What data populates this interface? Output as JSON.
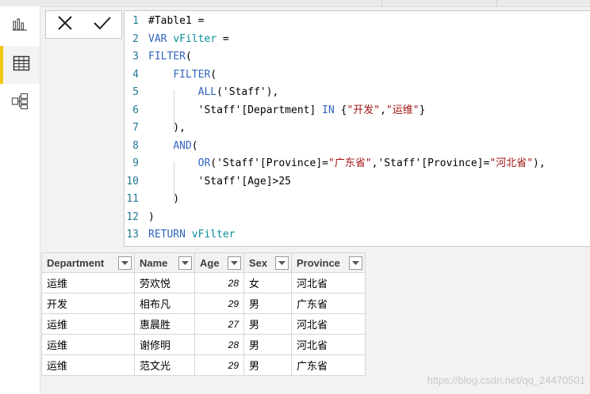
{
  "nav": {
    "items": [
      {
        "name": "report-view",
        "icon": "bar-chart-icon",
        "active": false
      },
      {
        "name": "data-view",
        "icon": "table-grid-icon",
        "active": true
      },
      {
        "name": "model-view",
        "icon": "model-diagram-icon",
        "active": false
      }
    ]
  },
  "formula_bar": {
    "cancel_icon": "close-x-icon",
    "commit_icon": "checkmark-icon",
    "lines": [
      {
        "n": "1",
        "text": "#Table1 ="
      },
      {
        "n": "2",
        "text": "VAR vFilter ="
      },
      {
        "n": "3",
        "text": "FILTER("
      },
      {
        "n": "4",
        "text": "    FILTER("
      },
      {
        "n": "5",
        "text": "        ALL('Staff'),"
      },
      {
        "n": "6",
        "text": "        'Staff'[Department] IN {\"开发\",\"运维\"}"
      },
      {
        "n": "7",
        "text": "    ),"
      },
      {
        "n": "8",
        "text": "    AND("
      },
      {
        "n": "9",
        "text": "        OR('Staff'[Province]=\"广东省\",'Staff'[Province]=\"河北省\"),"
      },
      {
        "n": "10",
        "text": "        'Staff'[Age]>25"
      },
      {
        "n": "11",
        "text": "    )"
      },
      {
        "n": "12",
        "text": ")"
      },
      {
        "n": "13",
        "text": "RETURN vFilter"
      }
    ]
  },
  "table": {
    "columns": [
      "Department",
      "Name",
      "Age",
      "Sex",
      "Province"
    ],
    "rows": [
      [
        "运维",
        "劳欢悦",
        "28",
        "女",
        "河北省"
      ],
      [
        "开发",
        "相布凡",
        "29",
        "男",
        "广东省"
      ],
      [
        "运维",
        "惠晨胜",
        "27",
        "男",
        "河北省"
      ],
      [
        "运维",
        "谢修明",
        "28",
        "男",
        "河北省"
      ],
      [
        "运维",
        "范文光",
        "29",
        "男",
        "广东省"
      ]
    ]
  },
  "watermark": "https://blog.csdn.net/qq_24470501"
}
